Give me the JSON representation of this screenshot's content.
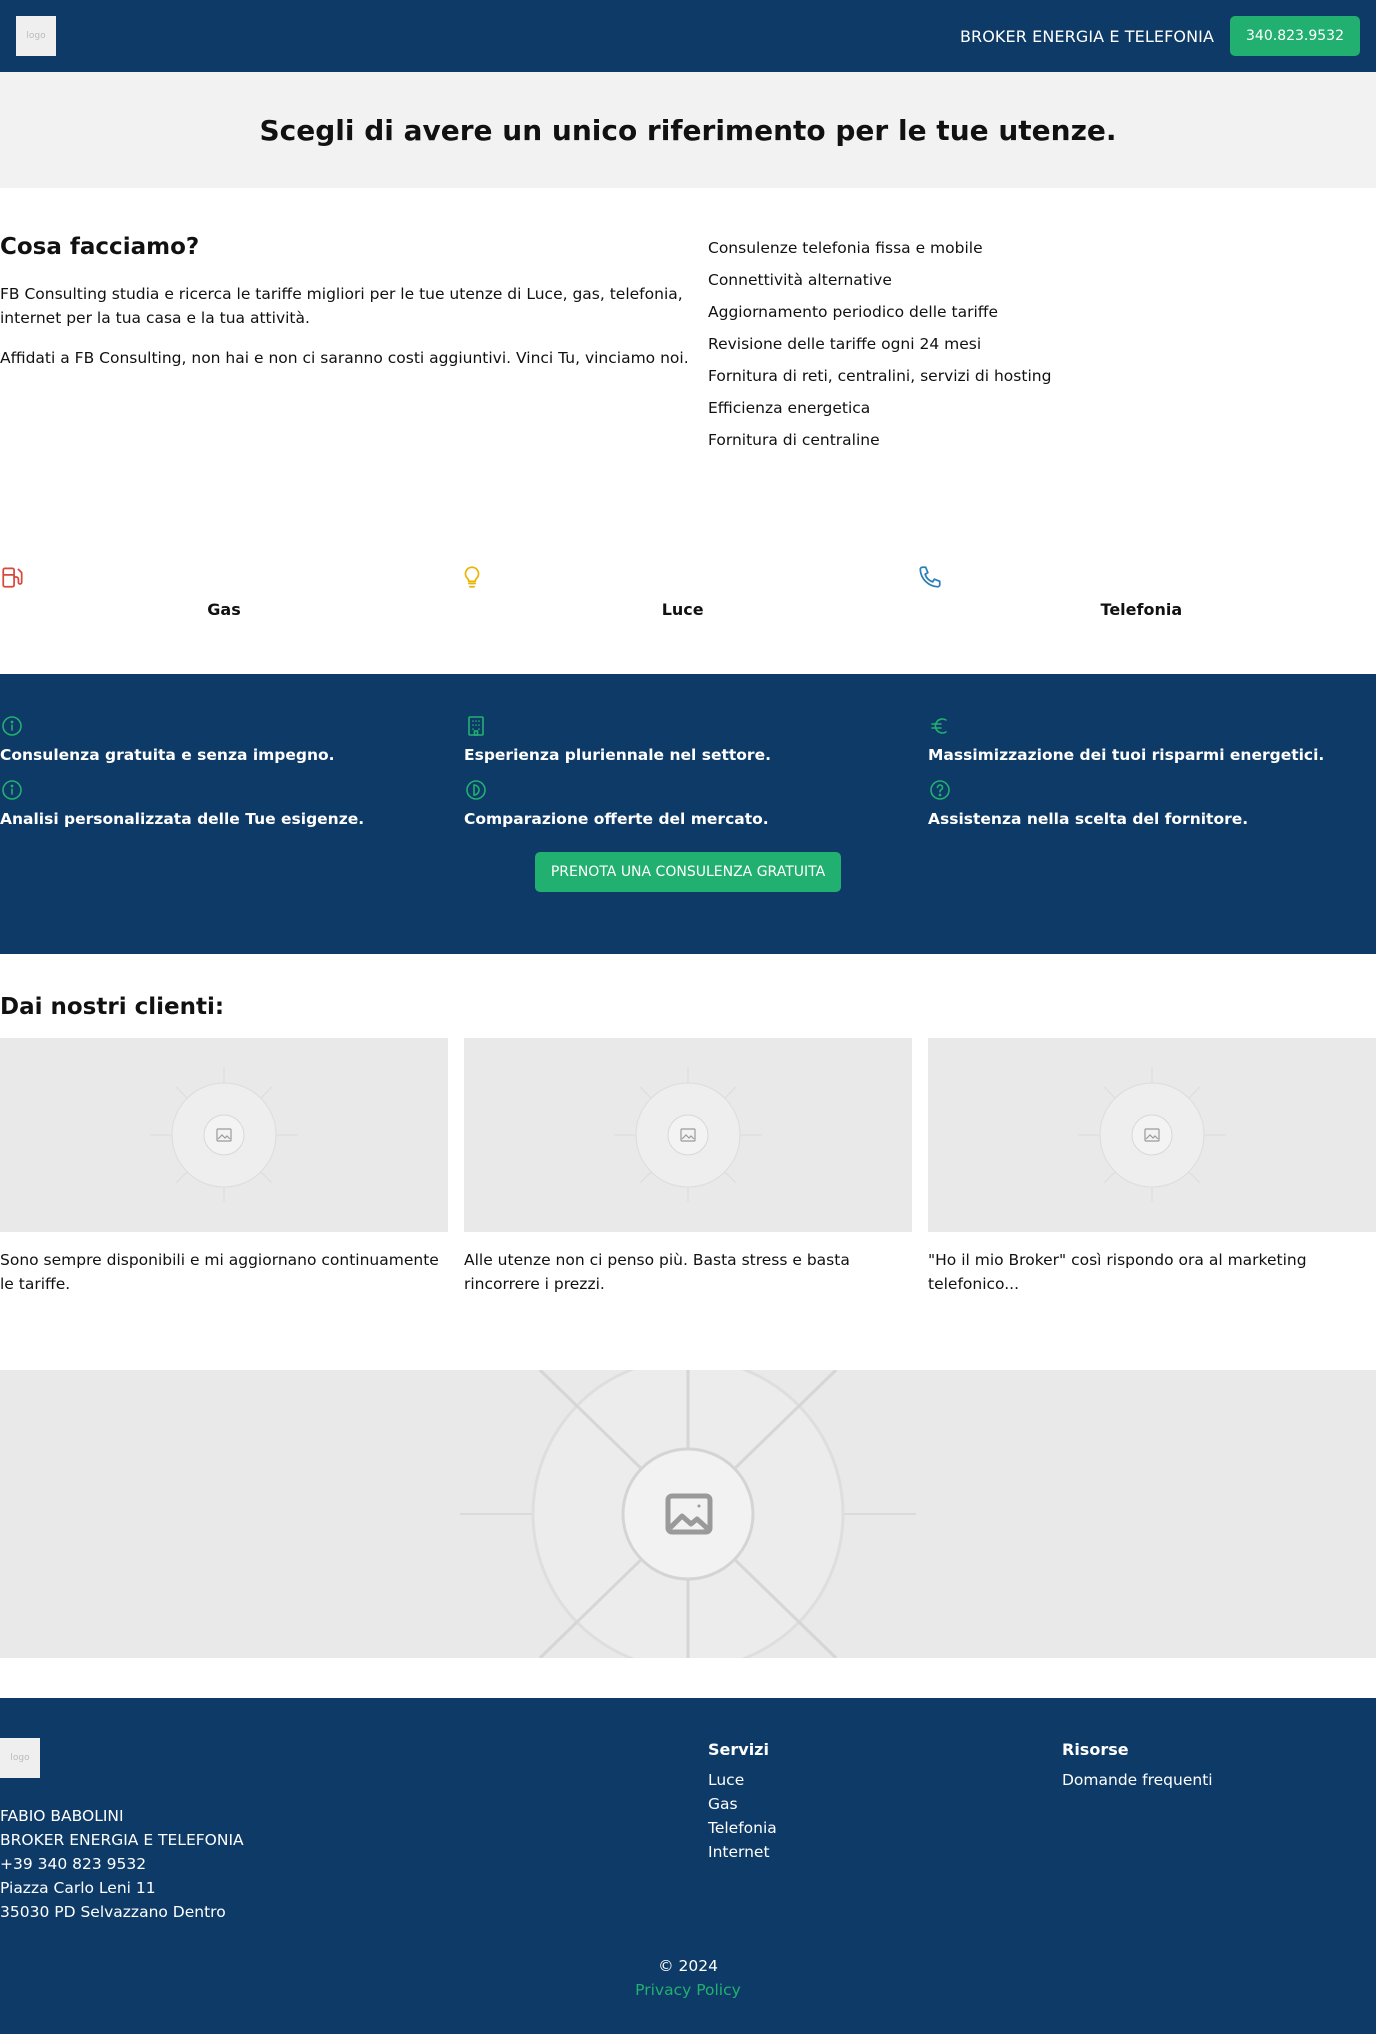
{
  "nav": {
    "logo_alt": "logo",
    "tagline": "BROKER ENERGIA E TELEFONIA",
    "phone_button": "340.823.9532"
  },
  "hero": {
    "title": "Scegli di avere un unico riferimento per le tue utenze."
  },
  "what": {
    "title": "Cosa facciamo?",
    "paragraphs": [
      "FB Consulting studia e ricerca le tariffe migliori per le tue utenze di Luce, gas, telefonia, internet per la tua casa e la tua attività.",
      "Affidati a FB Consulting, non hai e non ci saranno costi aggiuntivi. Vinci Tu, vinciamo noi."
    ],
    "services": [
      "Consulenze telefonia fissa e mobile",
      "Connettività alternative",
      "Aggiornamento periodico delle tariffe",
      "Revisione delle tariffe ogni 24 mesi",
      "Fornitura di reti, centralini, servizi di hosting",
      "Efficienza energetica",
      "Fornitura di centraline"
    ]
  },
  "utilities": [
    {
      "label": "Gas",
      "icon": "fuel-pump-icon",
      "color": "#d9473b"
    },
    {
      "label": "Luce",
      "icon": "lightbulb-icon",
      "color": "#e8b400"
    },
    {
      "label": "Telefonia",
      "icon": "phone-icon",
      "color": "#2a7fb8"
    }
  ],
  "benefits": [
    {
      "text": "Consulenza gratuita e senza impegno.",
      "icon": "info-icon"
    },
    {
      "text": "Esperienza pluriennale nel settore.",
      "icon": "building-icon"
    },
    {
      "text": "Massimizzazione dei tuoi risparmi energetici.",
      "icon": "euro-icon"
    },
    {
      "text": "Analisi personalizzata delle Tue esigenze.",
      "icon": "info-icon"
    },
    {
      "text": "Comparazione offerte del mercato.",
      "icon": "compare-icon"
    },
    {
      "text": "Assistenza nella scelta del fornitore.",
      "icon": "question-icon"
    }
  ],
  "cta": "PRENOTA UNA CONSULENZA GRATUITA",
  "clients": {
    "title": "Dai nostri clienti:",
    "items": [
      {
        "text": "Sono sempre disponibili e mi aggiornano continuamente le tariffe."
      },
      {
        "text": "Alle utenze non ci penso più. Basta stress e basta rincorrere i prezzi."
      },
      {
        "text": "\"Ho il mio Broker\" così rispondo ora al marketing telefonico..."
      }
    ]
  },
  "footer": {
    "logo_alt": "logo",
    "contact": [
      "FABIO BABOLINI",
      "BROKER ENERGIA E TELEFONIA",
      "+39 340 823 9532",
      "Piazza Carlo Leni 11",
      "35030 PD Selvazzano Dentro"
    ],
    "services_title": "Servizi",
    "services": [
      "Luce",
      "Gas",
      "Telefonia",
      "Internet"
    ],
    "resources_title": "Risorse",
    "resources": [
      "Domande frequenti"
    ],
    "copyright": "© 2024",
    "privacy": "Privacy Policy"
  },
  "colors": {
    "navy": "#0d3a66",
    "green": "#22b070",
    "hero_bg": "#f2f2f2",
    "placeholder_bg": "#e9e9e9"
  }
}
